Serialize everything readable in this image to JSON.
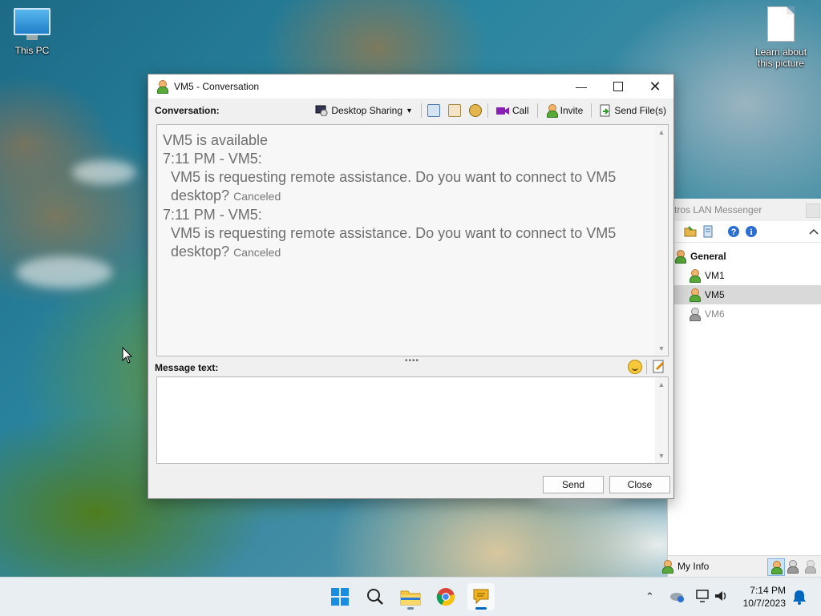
{
  "desktop": {
    "icons": [
      {
        "label": "This PC"
      },
      {
        "label": "Learn about\nthis picture"
      }
    ]
  },
  "main_window": {
    "title": "tros LAN Messenger",
    "group": "General",
    "buddies": [
      {
        "name": "VM1",
        "status": "online"
      },
      {
        "name": "VM5",
        "status": "online",
        "selected": true
      },
      {
        "name": "VM6",
        "status": "offline"
      }
    ],
    "my_info_label": "My Info"
  },
  "conversation": {
    "title": "VM5 - Conversation",
    "conversation_label": "Conversation:",
    "toolbar": {
      "desktop_sharing": "Desktop Sharing",
      "call": "Call",
      "invite": "Invite",
      "send_files": "Send File(s)"
    },
    "history": [
      {
        "kind": "status",
        "text": "VM5 is available"
      },
      {
        "kind": "header",
        "text": "7:11 PM - VM5:"
      },
      {
        "kind": "body",
        "text": "VM5 is requesting remote assistance. Do you want to connect to VM5",
        "cont": "desktop?",
        "note": "Canceled"
      },
      {
        "kind": "header",
        "text": "7:11 PM - VM5:"
      },
      {
        "kind": "body",
        "text": "VM5 is requesting remote assistance. Do you want to connect to VM5",
        "cont": "desktop?",
        "note": "Canceled"
      }
    ],
    "message_label": "Message text:",
    "message_value": "",
    "send_label": "Send",
    "close_label": "Close"
  },
  "taskbar": {
    "time": "7:14 PM",
    "date": "10/7/2023",
    "apps": [
      "start",
      "search",
      "file-explorer",
      "chrome",
      "lan-messenger"
    ]
  },
  "colors": {
    "accent": "#0067c0",
    "history_text": "#6e6e6e",
    "selected_row": "#d9d9d9"
  }
}
